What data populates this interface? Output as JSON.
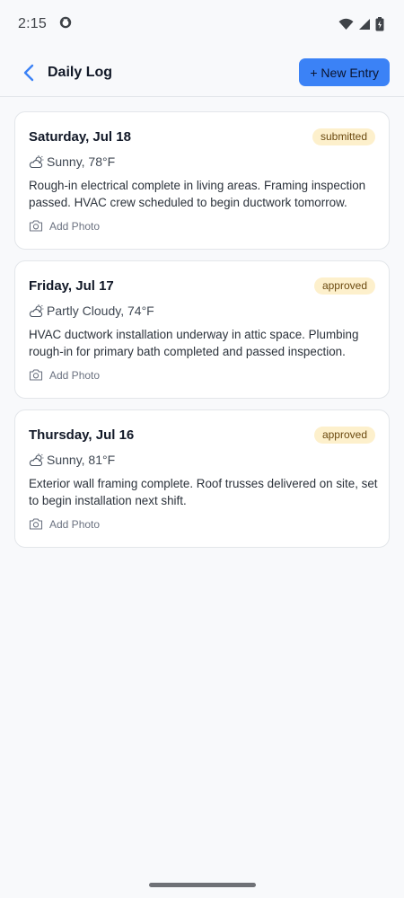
{
  "status_bar": {
    "time": "2:15",
    "icons": [
      "app-status-icon",
      "wifi-icon",
      "signal-icon",
      "battery-icon"
    ]
  },
  "header": {
    "title": "Daily Log",
    "back_icon": "chevron-left-icon",
    "new_entry_label": "+ New Entry"
  },
  "colors": {
    "accent": "#3b82f6",
    "badge_bg": "#fdf0cc",
    "badge_text": "#6b4a10"
  },
  "entries": [
    {
      "date": "Saturday, Jul 18",
      "status": "submitted",
      "weather": "Sunny, 78°F",
      "note": "Rough-in electrical complete in living areas. Framing inspection passed. HVAC crew scheduled to begin ductwork tomorrow.",
      "add_photo_label": "Add Photo"
    },
    {
      "date": "Friday, Jul 17",
      "status": "approved",
      "weather": "Partly Cloudy, 74°F",
      "note": "HVAC ductwork installation underway in attic space. Plumbing rough-in for primary bath completed and passed inspection.",
      "add_photo_label": "Add Photo"
    },
    {
      "date": "Thursday, Jul 16",
      "status": "approved",
      "weather": "Sunny, 81°F",
      "note": "Exterior wall framing complete. Roof trusses delivered on site, set to begin installation next shift.",
      "add_photo_label": "Add Photo"
    }
  ]
}
